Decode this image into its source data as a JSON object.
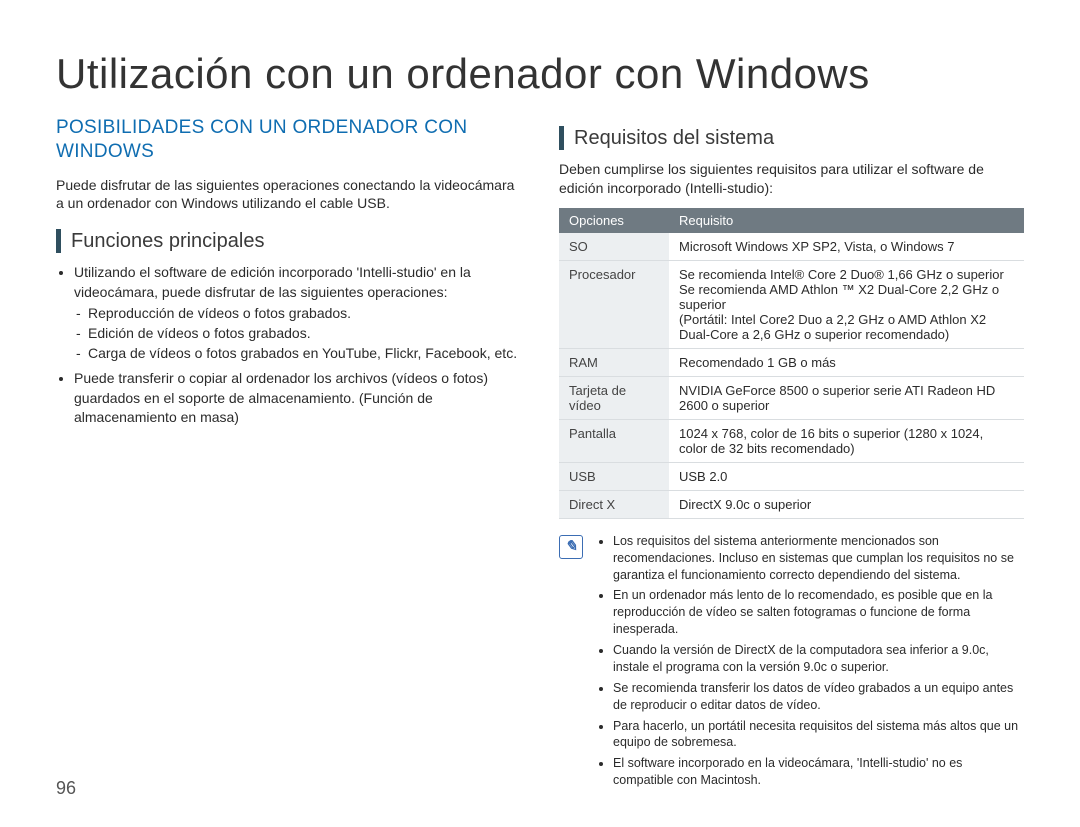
{
  "page_title": "Utilización con un ordenador con Windows",
  "page_number": "96",
  "left": {
    "heading": "POSIBILIDADES CON UN ORDENADOR CON WINDOWS",
    "intro": "Puede disfrutar de las siguientes operaciones conectando la videocámara a un ordenador con Windows utilizando el cable USB.",
    "sub1": "Funciones principales",
    "b1": "Utilizando el software de edición incorporado 'Intelli-studio' en la videocámara, puede disfrutar de las siguientes operaciones:",
    "d1": "Reproducción de vídeos o fotos grabados.",
    "d2": "Edición de vídeos o fotos grabados.",
    "d3": "Carga de vídeos o fotos grabados en YouTube, Flickr, Facebook, etc.",
    "b2": "Puede transferir o copiar al ordenador los archivos (vídeos o fotos) guardados en el soporte de almacenamiento. (Función de almacenamiento en masa)"
  },
  "right": {
    "sub1": "Requisitos del sistema",
    "intro": "Deben cumplirse los siguientes requisitos para utilizar el software de edición incorporado (Intelli-studio):",
    "table": {
      "head_opt": "Opciones",
      "head_req": "Requisito",
      "rows": [
        {
          "opt": "SO",
          "req": "Microsoft Windows XP SP2, Vista, o Windows 7"
        },
        {
          "opt": "Procesador",
          "req": "Se recomienda Intel® Core 2 Duo® 1,66 GHz o superior\nSe recomienda AMD Athlon ™ X2 Dual-Core 2,2 GHz o superior\n(Portátil: Intel Core2 Duo a 2,2 GHz o AMD Athlon X2 Dual-Core a 2,6 GHz o superior recomendado)"
        },
        {
          "opt": "RAM",
          "req": "Recomendado 1 GB o más"
        },
        {
          "opt": "Tarjeta de vídeo",
          "req": "NVIDIA GeForce 8500 o superior serie ATI Radeon HD 2600 o superior"
        },
        {
          "opt": "Pantalla",
          "req": "1024 x 768, color de 16 bits o superior (1280 x 1024, color de 32 bits recomendado)"
        },
        {
          "opt": "USB",
          "req": "USB 2.0"
        },
        {
          "opt": "Direct X",
          "req": "DirectX 9.0c o superior"
        }
      ]
    },
    "notes": [
      "Los requisitos del sistema anteriormente mencionados son recomendaciones. Incluso en sistemas que cumplan los requisitos no se garantiza el funcionamiento correcto dependiendo del sistema.",
      "En un ordenador más lento de lo recomendado, es posible que en la reproducción de vídeo se salten fotogramas o funcione de forma inesperada.",
      "Cuando la versión de DirectX de la computadora sea inferior a 9.0c, instale el programa con la versión 9.0c o superior.",
      "Se recomienda transferir los datos de vídeo grabados a un equipo antes de reproducir o editar datos de vídeo.",
      "Para hacerlo, un portátil necesita requisitos del sistema más altos que un equipo de sobremesa.",
      "El software incorporado en la videocámara, 'Intelli-studio' no es compatible con Macintosh."
    ]
  }
}
